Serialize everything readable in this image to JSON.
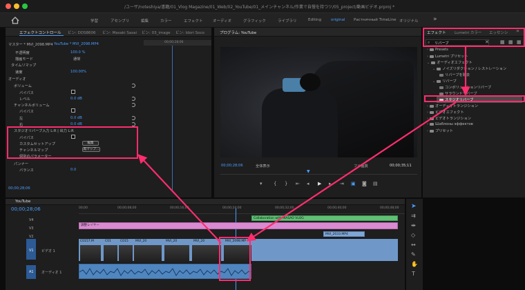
{
  "window": {
    "title": "/ユーザ/noteshiya/書籍/01_Vlog Magazine/01_Web/02_YouTube/01_メインチャンネル/作業で自慢を持つツ/05_project/動画ビデオ.prproj *"
  },
  "workspaces": {
    "items": [
      "学習",
      "アセンブリ",
      "編集",
      "カラー",
      "エフェクト",
      "オーディオ",
      "グラフィック",
      "ライブラリ",
      "Editing",
      "original",
      "Растничный TimeLine",
      "オリジナル"
    ],
    "active_index": 9
  },
  "effect_controls": {
    "tabs": [
      "エフェクトコントロール",
      "ビン: DDS8606",
      "ビン: Masaki Sasai",
      "ビン: 03_image",
      "ビン: Idori Soco"
    ],
    "header_source": "マスター * MVI_2098.MP4",
    "header_clip": "YouTube * MVI_2098.MP4",
    "timecode_top": "00;00;28;06",
    "rows": [
      {
        "label": "不透明度",
        "value": "100.0 %",
        "kind": "prop"
      },
      {
        "label": "描画モード",
        "value": "通常",
        "kind": "select"
      },
      {
        "label": "タイムリマップ",
        "value": "",
        "kind": "group"
      },
      {
        "label": "速度",
        "value": "100.00%",
        "kind": "prop"
      },
      {
        "label": "オーディオ",
        "value": "",
        "kind": "section"
      },
      {
        "label": "ボリューム",
        "value": "",
        "kind": "fx"
      },
      {
        "label": "バイパス",
        "value": "",
        "kind": "check"
      },
      {
        "label": "レベル",
        "value": "0.0 dB",
        "kind": "prop"
      },
      {
        "label": "チャンネルボリューム",
        "value": "",
        "kind": "fx"
      },
      {
        "label": "バイパス",
        "value": "",
        "kind": "check"
      },
      {
        "label": "左",
        "value": "0.0 dB",
        "kind": "prop"
      },
      {
        "label": "右",
        "value": "0.0 dB",
        "kind": "prop"
      }
    ],
    "studio_reverb": {
      "label": "スタジオリバーブ入力 L:R | 出力 L:R",
      "rows": [
        "バイパス",
        "カスタムセットアップ",
        "チャンネルマップ",
        "個別のパラメーター"
      ],
      "edit_button": "編集",
      "map_button": "再マップ..."
    },
    "panner": {
      "label": "パンナー",
      "balance_label": "バランス",
      "balance_value": "0.0"
    },
    "timecode_bottom": "00;00;28;06"
  },
  "program_monitor": {
    "title": "プログラム: YouTube",
    "timecode_left": "00;00;28;06",
    "fit_label": "全体表示",
    "quality_label": "フル画質",
    "timecode_right": "00;00;35;11"
  },
  "effects_panel": {
    "tabs": [
      "エフェクト",
      "Lumetri カラー",
      "エッセンシ"
    ],
    "search_value": "リバーブ",
    "tree": [
      {
        "label": "Presets",
        "depth": 0,
        "open": false
      },
      {
        "label": "Lumetri プリセット",
        "depth": 0,
        "open": false
      },
      {
        "label": "オーディオエフェクト",
        "depth": 0,
        "open": true
      },
      {
        "label": "ノイズリダクション / レストレーション",
        "depth": 1,
        "open": true
      },
      {
        "label": "リバーブを除去",
        "depth": 2,
        "open": false
      },
      {
        "label": "リバーブ",
        "depth": 1,
        "open": true
      },
      {
        "label": "コンボリューションリバーブ",
        "depth": 2,
        "open": false
      },
      {
        "label": "サラウンドリバーブ",
        "depth": 2,
        "open": false
      },
      {
        "label": "スタジオリバーブ",
        "depth": 2,
        "open": false,
        "selected": true
      },
      {
        "label": "オーディオトランジション",
        "depth": 0,
        "open": false
      },
      {
        "label": "ビデオエフェクト",
        "depth": 0,
        "open": false
      },
      {
        "label": "ビデオトランジション",
        "depth": 0,
        "open": false
      },
      {
        "label": "Шаблоны эффектов",
        "depth": 0,
        "open": false
      },
      {
        "label": "プリセット",
        "depth": 0,
        "open": false
      }
    ]
  },
  "timeline": {
    "sequence_tab": "YouTube",
    "timecode": "00;00;28;06",
    "ruler": [
      "00;00",
      "00;00;08;00",
      "00;00;16;00",
      "00;00;24;00",
      "00;00;32;00",
      "00;00;40;00",
      "00;00;48;00",
      "00;00;56;00"
    ],
    "tracks": {
      "v4": "V4",
      "v3": "V3",
      "v2": "V2",
      "v1": "V1",
      "v1_name": "ビデオ 1",
      "a1": "A1",
      "a1_name": "オーディオ 1"
    },
    "clips": {
      "green": "Collaboration with    MASAO VLOG",
      "adjustment": "調整レイヤー",
      "upper_a": "MVI_2033.MP4",
      "upper_b": "MVI_2066.MP4",
      "v1_labels": [
        "C0157.M",
        "C01",
        "C015",
        "MVI_20",
        "MVI_20",
        "MVI_20",
        "MVI_2098.MP"
      ]
    }
  },
  "annotation_color": "#ff2d6e",
  "accent_color": "#4a9eff"
}
